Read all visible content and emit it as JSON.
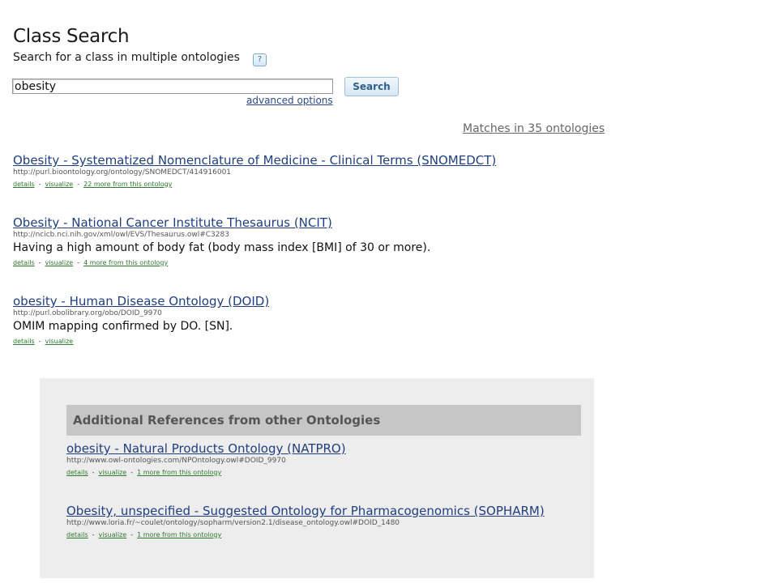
{
  "header": {
    "title": "Class Search",
    "subtitle": "Search for a class in multiple ontologies",
    "help_icon": "question-mark-icon"
  },
  "search": {
    "value": "obesity",
    "button_label": "Search",
    "advanced_link": "advanced options"
  },
  "matches_link": "Matches in 35 ontologies",
  "results": [
    {
      "title": "Obesity - Systematized Nomenclature of Medicine - Clinical Terms (SNOMEDCT)",
      "uri": "http://purl.bioontology.org/ontology/SNOMEDCT/414916001",
      "definition": "",
      "details": "details",
      "visualize": "visualize",
      "more": "22 more from this ontology"
    },
    {
      "title": "Obesity - National Cancer Institute Thesaurus (NCIT)",
      "uri": "http://ncicb.nci.nih.gov/xml/owl/EVS/Thesaurus.owl#C3283",
      "definition": "Having a high amount of body fat (body mass index [BMI] of 30 or more).",
      "details": "details",
      "visualize": "visualize",
      "more": "4 more from this ontology"
    },
    {
      "title": "obesity - Human Disease Ontology (DOID)",
      "uri": "http://purl.obolibrary.org/obo/DOID_9970",
      "definition": "OMIM mapping confirmed by DO. [SN].",
      "details": "details",
      "visualize": "visualize",
      "more": ""
    }
  ],
  "additional": {
    "header": "Additional References from other Ontologies",
    "items": [
      {
        "title": "obesity - Natural Products Ontology (NATPRO)",
        "uri": "http://www.owl-ontologies.com/NPOntology.owl#DOID_9970",
        "details": "details",
        "visualize": "visualize",
        "more": "1 more from this ontology"
      },
      {
        "title": "Obesity, unspecified - Suggested Ontology for Pharmacogenomics (SOPHARM)",
        "uri": "http://www.loria.fr/~coulet/ontology/sopharm/version2.1/disease_ontology.owl#DOID_1480",
        "details": "details",
        "visualize": "visualize",
        "more": "1 more from this ontology"
      }
    ]
  },
  "colors": {
    "link": "#1f3f7f",
    "small_link": "#2f7a2f",
    "panel_bg": "#ededed",
    "panel_header_bg": "#c6c6c6"
  }
}
